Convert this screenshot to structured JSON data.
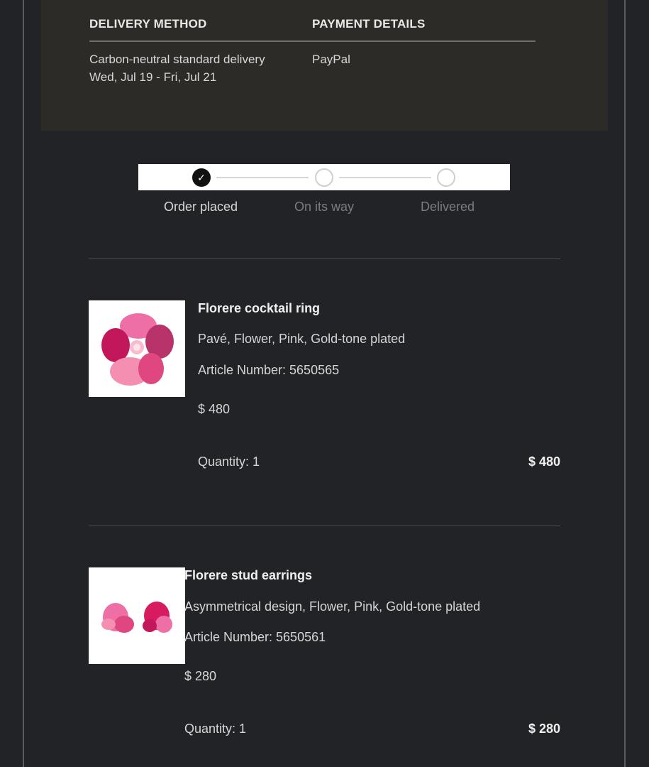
{
  "order_details": {
    "delivery_heading": "DELIVERY METHOD",
    "delivery_method": "Carbon-neutral standard delivery",
    "delivery_window": "Wed, Jul 19 - Fri, Jul 21",
    "payment_heading": "PAYMENT DETAILS",
    "payment_method": "PayPal"
  },
  "tracker": {
    "steps": [
      {
        "label": "Order placed",
        "completed": true
      },
      {
        "label": "On its way",
        "completed": false
      },
      {
        "label": "Delivered",
        "completed": false
      }
    ]
  },
  "items": [
    {
      "title": "Florere cocktail ring",
      "description": "Pavé, Flower, Pink, Gold-tone plated",
      "article": "Article Number: 5650565",
      "price": "$ 480",
      "quantity": "Quantity: 1",
      "total": "$ 480"
    },
    {
      "title": "Florere stud earrings",
      "description": "Asymmetrical design, Flower, Pink, Gold-tone plated",
      "article": "Article Number: 5650561",
      "price": "$ 280",
      "quantity": "Quantity: 1",
      "total": "$ 280"
    }
  ],
  "colors": {
    "page_bg": "#222327",
    "card_bg": "#2c2b27",
    "accent_pink": "#e0467f"
  }
}
